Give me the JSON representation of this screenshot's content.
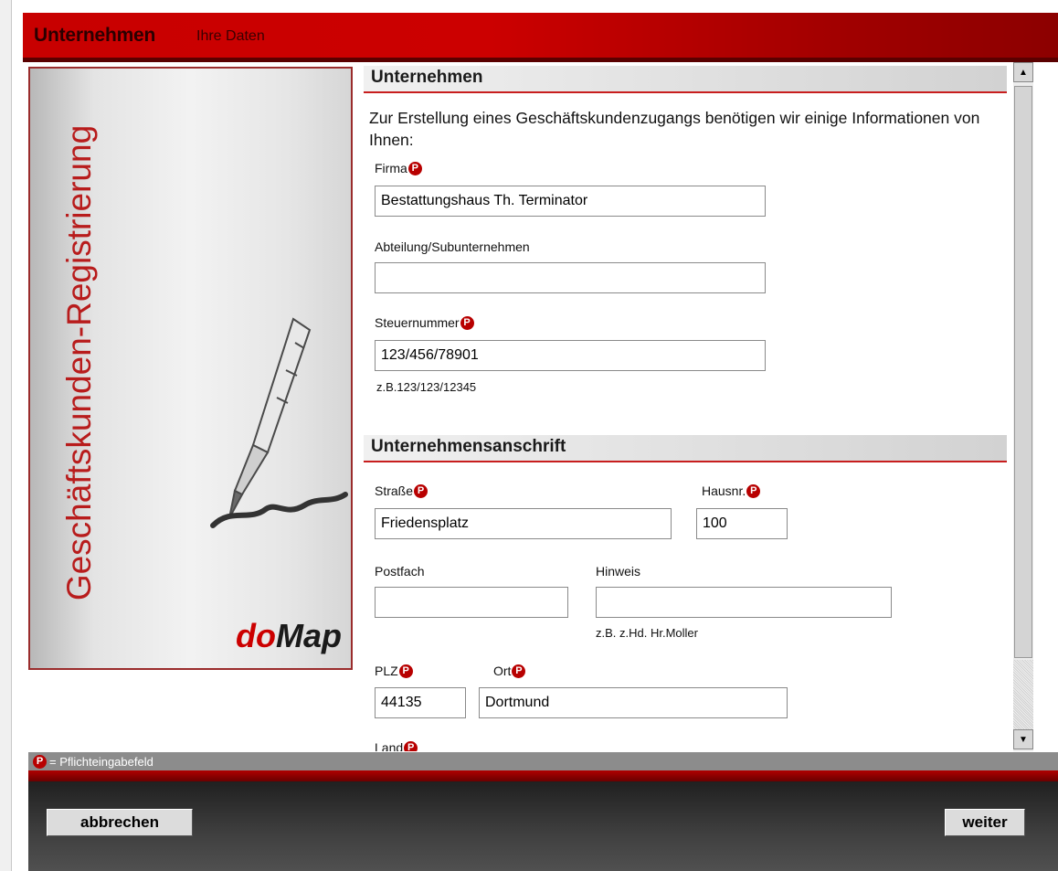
{
  "header": {
    "title": "Unternehmen",
    "subtitle": "Ihre Daten"
  },
  "sidebar": {
    "title": "Geschäftskunden-Registrierung",
    "logo_do": "do",
    "logo_map": "Map"
  },
  "section_company": {
    "heading": "Unternehmen",
    "intro": "Zur Erstellung eines Geschäftskundenzugangs benötigen wir einige Informationen von Ihnen:",
    "firma_label": "Firma",
    "firma_value": "Bestattungshaus Th. Terminator",
    "abteilung_label": "Abteilung/Subunternehmen",
    "abteilung_value": "",
    "steuer_label": "Steuernummer",
    "steuer_value": "123/456/78901",
    "steuer_hint": "z.B.123/123/12345"
  },
  "section_address": {
    "heading": "Unternehmensanschrift",
    "strasse_label": "Straße",
    "strasse_value": "Friedensplatz",
    "hausnr_label": "Hausnr.",
    "hausnr_value": "100",
    "postfach_label": "Postfach",
    "postfach_value": "",
    "hinweis_label": "Hinweis",
    "hinweis_value": "",
    "hinweis_hint": "z.B. z.Hd. Hr.Moller",
    "plz_label": "PLZ",
    "plz_value": "44135",
    "ort_label": "Ort",
    "ort_value": "Dortmund",
    "land_label": "Land"
  },
  "required_marker": "P",
  "legend": "= Pflichteingabefeld",
  "buttons": {
    "cancel": "abbrechen",
    "next": "weiter"
  },
  "icons": {
    "scroll_up": "▲",
    "scroll_down": "▼"
  }
}
